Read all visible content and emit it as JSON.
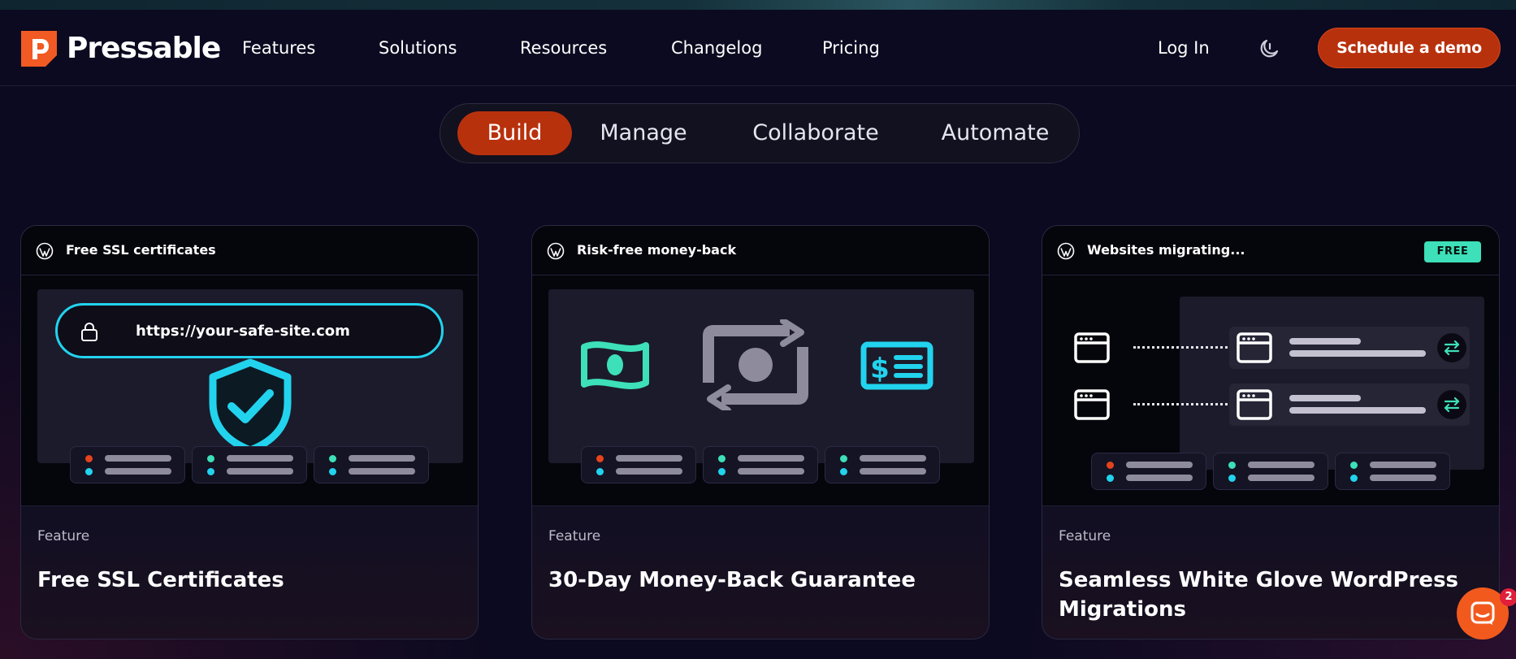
{
  "brand": {
    "name": "Pressable",
    "colors": {
      "accent": "#b8310d",
      "cyan": "#22d3ee",
      "mint": "#3de0b8"
    }
  },
  "nav": {
    "items": [
      {
        "label": "Features"
      },
      {
        "label": "Solutions"
      },
      {
        "label": "Resources"
      },
      {
        "label": "Changelog"
      },
      {
        "label": "Pricing"
      }
    ],
    "login": "Log In",
    "theme_toggle_icon": "moon-icon",
    "cta": "Schedule a demo"
  },
  "tabs": [
    {
      "label": "Build",
      "active": true
    },
    {
      "label": "Manage",
      "active": false
    },
    {
      "label": "Collaborate",
      "active": false
    },
    {
      "label": "Automate",
      "active": false
    }
  ],
  "cards": [
    {
      "header": "Free SSL certificates",
      "url": "https://your-safe-site.com",
      "eyebrow": "Feature",
      "title": "Free SSL Certificates"
    },
    {
      "header": "Risk-free money-back",
      "eyebrow": "Feature",
      "title": "30-Day Money-Back Guarantee"
    },
    {
      "header": "Websites migrating...",
      "badge": "FREE",
      "eyebrow": "Feature",
      "title": "Seamless White Glove WordPress Migrations"
    }
  ],
  "chat": {
    "icon": "chat-icon",
    "badge_count": "2"
  }
}
